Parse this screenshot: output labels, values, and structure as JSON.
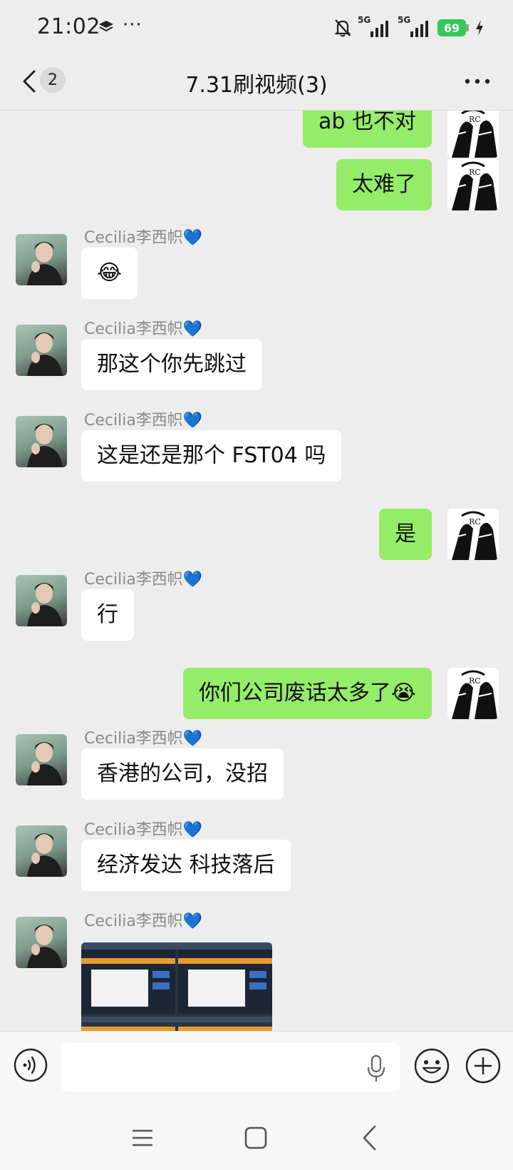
{
  "status_bar": {
    "time": "21:02",
    "dots": "···",
    "signal_1_label": "5G",
    "signal_2_label": "5G",
    "battery_level": "69",
    "icons": [
      "layers-icon",
      "mute-bell-icon",
      "signal-icon",
      "battery-icon",
      "charging-bolt-icon"
    ]
  },
  "header": {
    "unread_count": "2",
    "title": "7.31刷视频(3)",
    "icons": [
      "back-chevron-icon",
      "more-dots-icon"
    ]
  },
  "messages": [
    {
      "side": "out",
      "text": "ab 也不对"
    },
    {
      "side": "out",
      "text": "太难了"
    },
    {
      "side": "in",
      "sender": "Cecilia李西帜",
      "sender_emoji": "💙",
      "text": "😂"
    },
    {
      "side": "in",
      "sender": "Cecilia李西帜",
      "sender_emoji": "💙",
      "text": "那这个你先跳过"
    },
    {
      "side": "in",
      "sender": "Cecilia李西帜",
      "sender_emoji": "💙",
      "text": "这是还是那个 FST04 吗"
    },
    {
      "side": "out",
      "text": "是"
    },
    {
      "side": "in",
      "sender": "Cecilia李西帜",
      "sender_emoji": "💙",
      "text": "行"
    },
    {
      "side": "out",
      "text": "你们公司废话太多了😭"
    },
    {
      "side": "in",
      "sender": "Cecilia李西帜",
      "sender_emoji": "💙",
      "text": "香港的公司，没招"
    },
    {
      "side": "in",
      "sender": "Cecilia李西帜",
      "sender_emoji": "💙",
      "text": "经济发达 科技落后"
    },
    {
      "side": "in",
      "sender": "Cecilia李西帜",
      "sender_emoji": "💙",
      "type": "image"
    }
  ],
  "input": {
    "value": "",
    "icons": [
      "voice-icon",
      "mic-icon",
      "emoji-icon",
      "plus-icon"
    ]
  },
  "colors": {
    "outgoing_bubble": "#95ec69",
    "incoming_bubble": "#ffffff",
    "background": "#ededed",
    "battery": "#34c759"
  }
}
